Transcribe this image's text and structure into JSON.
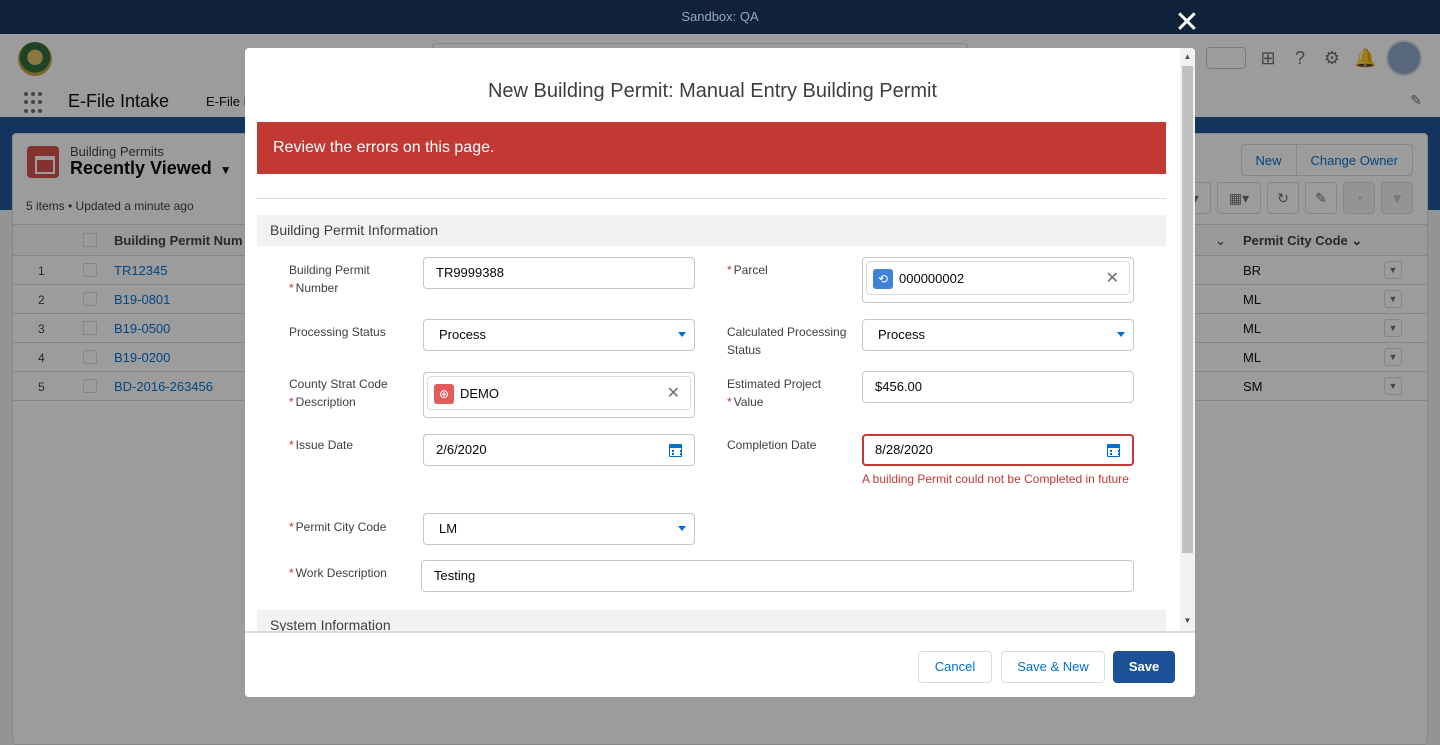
{
  "sandbox": {
    "label": "Sandbox: QA"
  },
  "app": {
    "name": "E-File Intake",
    "nav_tab": "E-File I",
    "list": {
      "object_label": "Building Permits",
      "view_name": "Recently Viewed",
      "meta": "5 items • Updated a minute ago",
      "buttons": [
        "New",
        "Change Owner"
      ],
      "columns": [
        "Building Permit Num",
        "Permit City Code"
      ],
      "rows": [
        {
          "num": "1",
          "permit": "TR12345",
          "city": "BR"
        },
        {
          "num": "2",
          "permit": "B19-0801",
          "city": "ML"
        },
        {
          "num": "3",
          "permit": "B19-0500",
          "city": "ML"
        },
        {
          "num": "4",
          "permit": "B19-0200",
          "city": "ML"
        },
        {
          "num": "5",
          "permit": "BD-2016-263456",
          "city": "SM"
        }
      ]
    }
  },
  "modal": {
    "title": "New Building Permit: Manual Entry Building Permit",
    "error_banner": "Review the errors on this page.",
    "section_info": "Building Permit Information",
    "section_system": "System Information",
    "fields": {
      "permit_number": {
        "label_line1": "Building Permit",
        "label_line2": "Number",
        "value": "TR9999388"
      },
      "parcel": {
        "label": "Parcel",
        "value": "000000002"
      },
      "processing_status": {
        "label": "Processing Status",
        "value": "Process"
      },
      "calc_processing_status": {
        "label_line1": "Calculated Processing",
        "label_line2": "Status",
        "value": "Process"
      },
      "county_strat": {
        "label_line1": "County Strat Code",
        "label_line2": "Description",
        "value": "DEMO"
      },
      "estimated_value": {
        "label_line1": "Estimated Project",
        "label_line2": "Value",
        "value": "$456.00"
      },
      "issue_date": {
        "label": "Issue Date",
        "value": "2/6/2020"
      },
      "completion_date": {
        "label": "Completion Date",
        "value": "8/28/2020",
        "error": "A building Permit could not be Completed in future"
      },
      "permit_city_code": {
        "label": "Permit City Code",
        "value": "LM"
      },
      "work_description": {
        "label": "Work Description",
        "value": "Testing"
      }
    },
    "footer": {
      "cancel": "Cancel",
      "save_new": "Save & New",
      "save": "Save"
    }
  },
  "colors": {
    "brand": "#1b5297",
    "error": "#c23934",
    "link": "#0070d2"
  },
  "icons": {
    "close": "close-icon",
    "calendar": "calendar-icon",
    "select": "chevron-down-icon",
    "parcel": "parcel-icon",
    "globe": "globe-icon"
  }
}
